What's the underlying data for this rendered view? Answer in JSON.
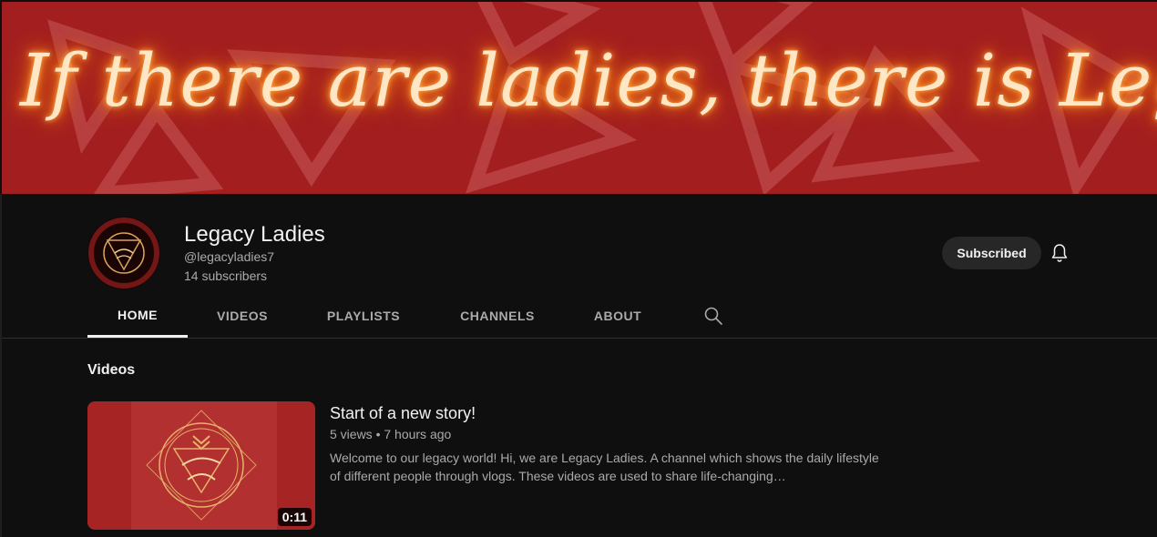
{
  "banner": {
    "text": "If there are ladies, there is Legacy!",
    "background_color": "#a31f1f",
    "glow_color": "#ffb14a"
  },
  "channel": {
    "name": "Legacy Ladies",
    "handle": "@legacyladies7",
    "subscribers": "14 subscribers",
    "subscribe_label": "Subscribed"
  },
  "tabs": [
    {
      "label": "HOME",
      "active": true
    },
    {
      "label": "VIDEOS",
      "active": false
    },
    {
      "label": "PLAYLISTS",
      "active": false
    },
    {
      "label": "CHANNELS",
      "active": false
    },
    {
      "label": "ABOUT",
      "active": false
    }
  ],
  "section": {
    "title": "Videos"
  },
  "video": {
    "title": "Start of a new story!",
    "meta": "5 views • 7 hours ago",
    "description": "Welcome to our legacy world! Hi, we are Legacy Ladies. A channel which shows the daily lifestyle of different people through vlogs. These videos are used to share life-changing…",
    "duration": "0:11",
    "thumbnail_color": "#a72424"
  },
  "icons": {
    "bell": "bell-icon",
    "search": "search-icon"
  }
}
